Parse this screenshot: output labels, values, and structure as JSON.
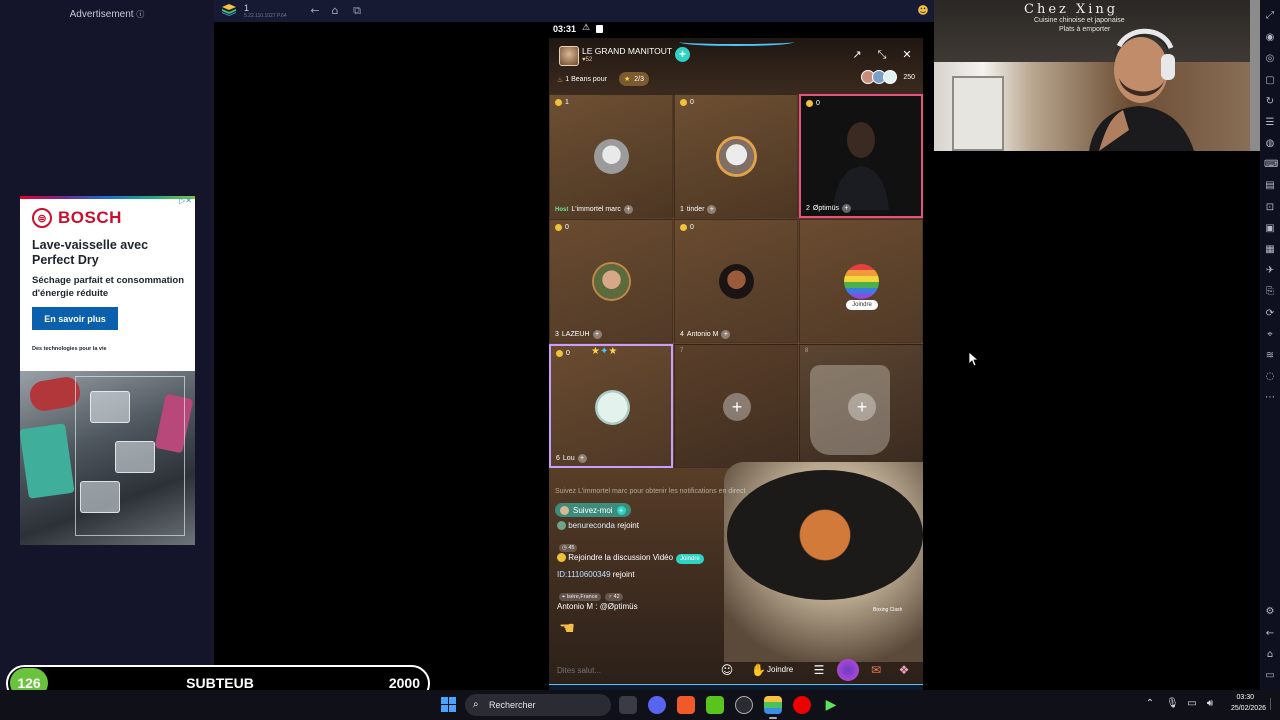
{
  "ad": {
    "header": "Advertisement",
    "brand": "BOSCH",
    "headline": "Lave-vaisselle avec Perfect Dry",
    "body": "Séchage parfait et consommation d'énergie réduite",
    "cta": "En savoir plus",
    "footer": "Des technologies pour la vie"
  },
  "scorebar": {
    "left_score": "126",
    "name": "SUBTEUB",
    "right_score": "2000"
  },
  "app_chrome": {
    "title": "1",
    "subtitle": "5.22.110.1027 P.64"
  },
  "webcam": {
    "sign_title": "Chez Xing",
    "sign_line1": "Cuisine chinoise et japonaise",
    "sign_line2": "Plats à emporter"
  },
  "phone": {
    "status_time": "03:31",
    "room": {
      "title": "LE GRAND MANITOUT",
      "likes": "52",
      "beans_label": "1 Beans pour",
      "rank": "2/3",
      "viewer_count": "250"
    },
    "seats": [
      {
        "coins": "1",
        "number": "Host",
        "name": "L'immortel marc",
        "state": "occupied"
      },
      {
        "coins": "0",
        "number": "1",
        "name": "tinder",
        "state": "occupied"
      },
      {
        "coins": "0",
        "number": "2",
        "name": "Øptimüs",
        "state": "video"
      },
      {
        "coins": "0",
        "number": "3",
        "name": "LAZEUH",
        "state": "occupied"
      },
      {
        "coins": "0",
        "number": "4",
        "name": "Antonio M",
        "state": "occupied"
      },
      {
        "coins": "",
        "number": "",
        "name": "",
        "state": "join",
        "join_label": "Joindre"
      },
      {
        "coins": "0",
        "number": "6",
        "name": "Lou",
        "state": "occupied"
      },
      {
        "coins": "",
        "number": "7",
        "name": "",
        "state": "empty"
      },
      {
        "coins": "",
        "number": "8",
        "name": "",
        "state": "empty"
      }
    ],
    "chat": {
      "notice": "Suivez L'immortel marc pour obtenir les notifications en direct",
      "follow_label": "Suivez-moi",
      "line1_user": "benureconda",
      "line1_action": "rejoint",
      "line1_badge": "45",
      "line2_text": "Rejoindre la discussion Vidéo",
      "line2_badge": "Joindre",
      "line3_user": "ID:1110600349",
      "line3_action": "rejoint",
      "line3_loc": "Isère,France",
      "line3_badge": "42",
      "line4": "Antonio M : @Øptimüs"
    },
    "boxing": "Boxing Clash",
    "input": {
      "placeholder": "Dites salut...",
      "join_label": "Joindre"
    }
  },
  "taskbar": {
    "search_label": "Rechercher",
    "time": "03:30",
    "date": "25/02/2026"
  },
  "colors": {
    "accent_teal": "#2ed3c4",
    "seat_highlight_pink": "#e8507e",
    "seat_highlight_purple": "#c7a0ff",
    "bosch_red": "#c8102e",
    "bosch_blue": "#0a60ac",
    "score_green": "#6ac33d"
  },
  "icons": [
    "info-icon",
    "ad-close-icon",
    "back-icon",
    "home-icon",
    "copy-icon",
    "share-icon",
    "minimize-icon",
    "close-icon",
    "search-icon",
    "windows-start-icon",
    "wifi-icon",
    "volume-icon",
    "mic-icon",
    "emoji-icon",
    "hand-icon",
    "menu-icon",
    "gift-icon"
  ]
}
